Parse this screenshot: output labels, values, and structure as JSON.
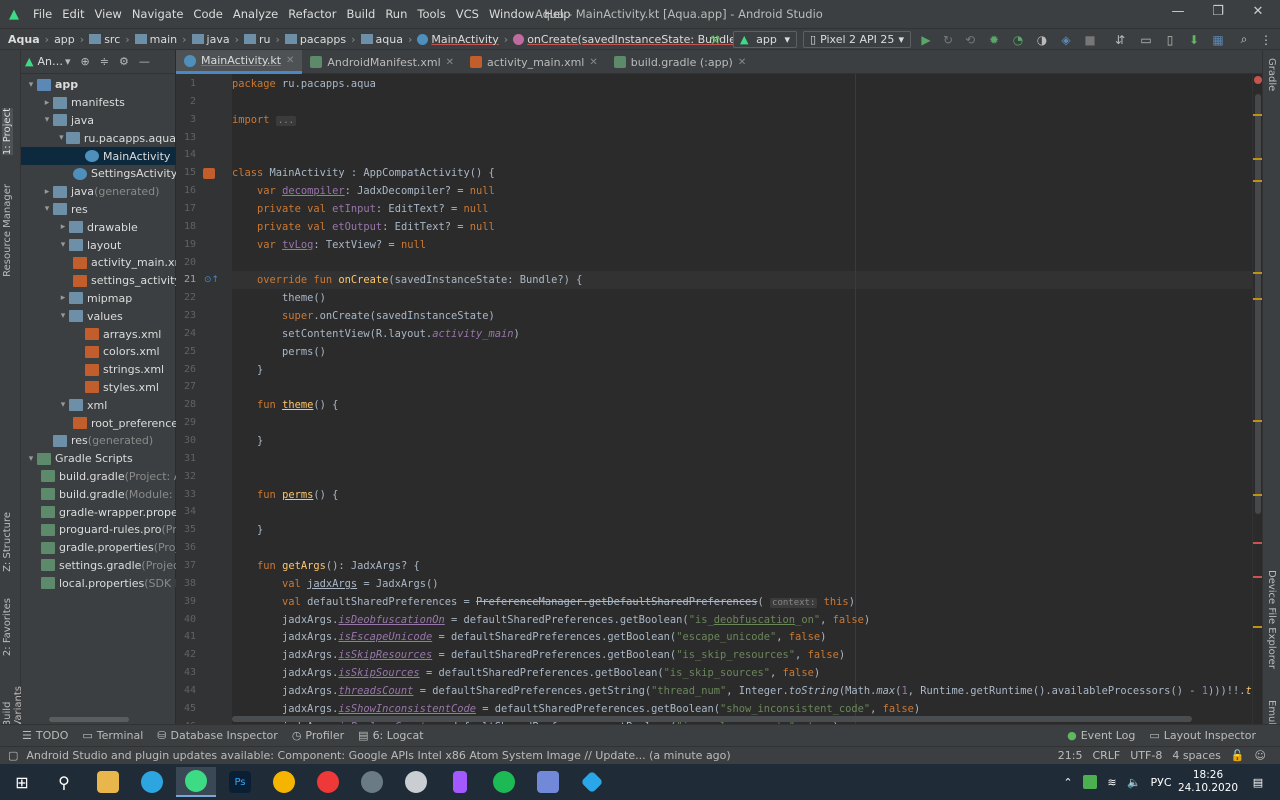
{
  "menu": {
    "items": [
      "File",
      "Edit",
      "View",
      "Navigate",
      "Code",
      "Analyze",
      "Refactor",
      "Build",
      "Run",
      "Tools",
      "VCS",
      "Window",
      "Help"
    ],
    "title": "Aqua - MainActivity.kt [Aqua.app] - Android Studio"
  },
  "nav": {
    "crumbs": [
      "Aqua",
      "app",
      "src",
      "main",
      "java",
      "ru",
      "pacapps",
      "aqua",
      "MainActivity",
      "onCreate(savedInstanceState: Bundle?)"
    ],
    "run_config": "app",
    "device": "Pixel 2 API 25"
  },
  "left_tools": [
    "1: Project",
    "Resource Manager",
    "Z: Structure",
    "2: Favorites",
    "Build Variants"
  ],
  "right_tools": [
    "Gradle",
    "Device File Explorer",
    "Emulator"
  ],
  "project": {
    "header": "An…",
    "tree": [
      {
        "label": "app",
        "indent": 0,
        "arrow": "▾",
        "icon": "fblue"
      },
      {
        "label": "manifests",
        "indent": 1,
        "arrow": "▸",
        "icon": "fold"
      },
      {
        "label": "java",
        "indent": 1,
        "arrow": "▾",
        "icon": "fold"
      },
      {
        "label": "ru.pacapps.aqua",
        "indent": 2,
        "arrow": "▾",
        "icon": "fold"
      },
      {
        "label": "MainActivity",
        "indent": 3,
        "arrow": "",
        "icon": "kt"
      },
      {
        "label": "SettingsActivity",
        "indent": 3,
        "arrow": "",
        "icon": "kt"
      },
      {
        "label": "java",
        "suffix": " (generated)",
        "indent": 1,
        "arrow": "▸",
        "icon": "fold"
      },
      {
        "label": "res",
        "indent": 1,
        "arrow": "▾",
        "icon": "fold"
      },
      {
        "label": "drawable",
        "indent": 2,
        "arrow": "▸",
        "icon": "fold"
      },
      {
        "label": "layout",
        "indent": 2,
        "arrow": "▾",
        "icon": "fold"
      },
      {
        "label": "activity_main.xml",
        "indent": 3,
        "arrow": "",
        "icon": "xmlic"
      },
      {
        "label": "settings_activity",
        "indent": 3,
        "arrow": "",
        "icon": "xmlic"
      },
      {
        "label": "mipmap",
        "indent": 2,
        "arrow": "▸",
        "icon": "fold"
      },
      {
        "label": "values",
        "indent": 2,
        "arrow": "▾",
        "icon": "fold"
      },
      {
        "label": "arrays.xml",
        "indent": 3,
        "arrow": "",
        "icon": "xmlic"
      },
      {
        "label": "colors.xml",
        "indent": 3,
        "arrow": "",
        "icon": "xmlic"
      },
      {
        "label": "strings.xml",
        "indent": 3,
        "arrow": "",
        "icon": "xmlic"
      },
      {
        "label": "styles.xml",
        "indent": 3,
        "arrow": "",
        "icon": "xmlic"
      },
      {
        "label": "xml",
        "indent": 2,
        "arrow": "▾",
        "icon": "fold"
      },
      {
        "label": "root_preference",
        "indent": 3,
        "arrow": "",
        "icon": "xmlic"
      },
      {
        "label": "res",
        "suffix": " (generated)",
        "indent": 1,
        "arrow": "",
        "icon": "fold"
      },
      {
        "label": "Gradle Scripts",
        "indent": 0,
        "arrow": "▾",
        "icon": "gr"
      },
      {
        "label": "build.gradle",
        "suffix": " (Project: A",
        "indent": 1,
        "arrow": "",
        "icon": "gr"
      },
      {
        "label": "build.gradle",
        "suffix": " (Module: A",
        "indent": 1,
        "arrow": "",
        "icon": "gr"
      },
      {
        "label": "gradle-wrapper.proper",
        "indent": 1,
        "arrow": "",
        "icon": "gr"
      },
      {
        "label": "proguard-rules.pro",
        "suffix": " (Pr",
        "indent": 1,
        "arrow": "",
        "icon": "gr"
      },
      {
        "label": "gradle.properties",
        "suffix": " (Proje",
        "indent": 1,
        "arrow": "",
        "icon": "gr"
      },
      {
        "label": "settings.gradle",
        "suffix": " (Project",
        "indent": 1,
        "arrow": "",
        "icon": "gr"
      },
      {
        "label": "local.properties",
        "suffix": " (SDK L",
        "indent": 1,
        "arrow": "",
        "icon": "gr"
      }
    ]
  },
  "tabs": [
    {
      "label": "MainActivity.kt",
      "active": true
    },
    {
      "label": "AndroidManifest.xml"
    },
    {
      "label": "activity_main.xml"
    },
    {
      "label": "build.gradle (:app)"
    }
  ],
  "code": {
    "lines": [
      {
        "n": "1",
        "h": "<span class='kw'>package</span> ru.pacapps.aqua"
      },
      {
        "n": "2",
        "h": ""
      },
      {
        "n": "3",
        "h": "<span class='kw'>import</span> <span class='hint'>...</span>"
      },
      {
        "n": "13",
        "h": ""
      },
      {
        "n": "14",
        "h": ""
      },
      {
        "n": "15",
        "h": "<span class='kw'>class</span> MainActivity : AppCompatActivity() {"
      },
      {
        "n": "16",
        "h": "    <span class='kw'>var</span> <span class='fld ul'>decompiler</span>: JadxDecompiler? = <span class='kw'>null</span>"
      },
      {
        "n": "17",
        "h": "    <span class='kw'>private val</span> <span class='fld'>etInput</span>: EditText? = <span class='kw'>null</span>"
      },
      {
        "n": "18",
        "h": "    <span class='kw'>private val</span> <span class='fld'>etOutput</span>: EditText? = <span class='kw'>null</span>"
      },
      {
        "n": "19",
        "h": "    <span class='kw'>var</span> <span class='fld ul'>tvLog</span>: TextView? = <span class='kw'>null</span>"
      },
      {
        "n": "20",
        "h": ""
      },
      {
        "n": "21",
        "h": "    <span class='kw'>override fun</span> <span class='fn'>onCreate</span>(savedInstanceState: Bundle?) {"
      },
      {
        "n": "22",
        "h": "        theme()"
      },
      {
        "n": "23",
        "h": "        <span class='kw'>super</span>.onCreate(savedInstanceState)"
      },
      {
        "n": "24",
        "h": "        setContentView(R.layout.<span class='fld it'>activity_main</span>)"
      },
      {
        "n": "25",
        "h": "        perms()"
      },
      {
        "n": "26",
        "h": "    }"
      },
      {
        "n": "27",
        "h": ""
      },
      {
        "n": "28",
        "h": "    <span class='kw'>fun</span> <span class='fn ul'>theme</span>() {"
      },
      {
        "n": "29",
        "h": ""
      },
      {
        "n": "30",
        "h": "    }"
      },
      {
        "n": "31",
        "h": ""
      },
      {
        "n": "32",
        "h": ""
      },
      {
        "n": "33",
        "h": "    <span class='kw'>fun</span> <span class='fn ul'>perms</span>() {"
      },
      {
        "n": "34",
        "h": ""
      },
      {
        "n": "35",
        "h": "    }"
      },
      {
        "n": "36",
        "h": ""
      },
      {
        "n": "37",
        "h": "    <span class='kw'>fun</span> <span class='fn'>getArgs</span>(): JadxArgs? {"
      },
      {
        "n": "38",
        "h": "        <span class='kw'>val</span> <span class='ul'>jadxArgs</span> = JadxArgs()"
      },
      {
        "n": "39",
        "h": "        <span class='kw'>val</span> defaultSharedPreferences = <span class='st'>PreferenceManager.getDefaultSharedPreferences</span>( <span class='hint'>context:</span> <span class='kw'>this</span>)"
      },
      {
        "n": "40",
        "h": "        jadxArgs.<span class='fld it ul'>isDeobfuscationOn</span> = defaultSharedPreferences.getBoolean(<span class='str'>\"is_<span class='ul'>deobfuscation</span>_on\"</span>, <span class='kw'>false</span>)"
      },
      {
        "n": "41",
        "h": "        jadxArgs.<span class='fld it ul'>isEscapeUnicode</span> = defaultSharedPreferences.getBoolean(<span class='str'>\"escape_unicode\"</span>, <span class='kw'>false</span>)"
      },
      {
        "n": "42",
        "h": "        jadxArgs.<span class='fld it ul'>isSkipResources</span> = defaultSharedPreferences.getBoolean(<span class='str'>\"is_skip_resources\"</span>, <span class='kw'>false</span>)"
      },
      {
        "n": "43",
        "h": "        jadxArgs.<span class='fld it ul'>isSkipSources</span> = defaultSharedPreferences.getBoolean(<span class='str'>\"is_skip_sources\"</span>, <span class='kw'>false</span>)"
      },
      {
        "n": "44",
        "h": "        jadxArgs.<span class='fld it ul'>threadsCount</span> = defaultSharedPreferences.getString(<span class='str'>\"thread_num\"</span>, Integer.<span class='it'>toString</span>(Math.<span class='it'>max</span>(<span class='fld'>1</span>, Runtime.getRuntime().availableProcessors() - <span class='fld'>1</span>)))!!.<span class='fn it'>toIn</span>"
      },
      {
        "n": "45",
        "h": "        jadxArgs.<span class='fld it ul'>isShowInconsistentCode</span> = defaultSharedPreferences.getBoolean(<span class='str'>\"show_inconsistent_code\"</span>, <span class='kw'>false</span>)"
      },
      {
        "n": "46",
        "h": "        jadxArgs.<span class='fld it ul'>isReplaceConsts</span> = defaultSharedPreferences.getBoolean(<span class='str'>\"is_replace_consts\"</span>, <span class='kw'>true</span>)"
      }
    ]
  },
  "bottom_tools": [
    "TODO",
    "Terminal",
    "Database Inspector",
    "Profiler",
    "6: Logcat"
  ],
  "bottom_right": [
    "Event Log",
    "Layout Inspector"
  ],
  "status": {
    "message": "Android Studio and plugin updates available: Component: Google APIs Intel x86 Atom System Image // Update... (a minute ago)",
    "position": "21:5",
    "line_sep": "CRLF",
    "encoding": "UTF-8",
    "indent": "4 spaces"
  },
  "taskbar": {
    "lang": "РУС",
    "time": "18:26",
    "date": "24.10.2020"
  }
}
